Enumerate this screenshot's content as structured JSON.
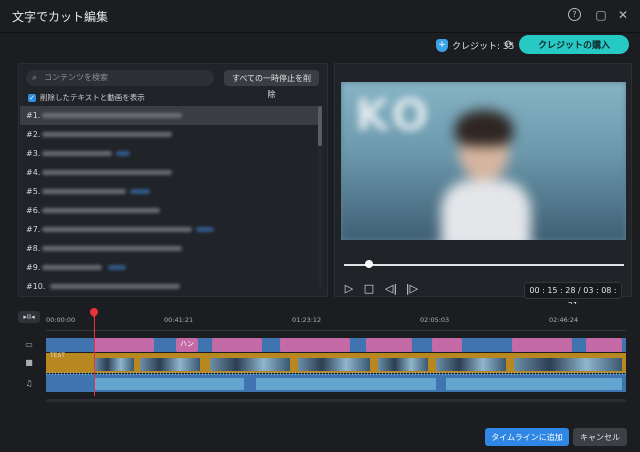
{
  "window": {
    "title": "文字でカット編集"
  },
  "titlebar": {
    "help_icon": "help-icon",
    "maximize_icon": "maximize-icon",
    "close_icon": "close-icon"
  },
  "toolbar": {
    "credits_label": "クレジット: 35",
    "buy_label": "クレジットの購入",
    "accent_color": "#26c9c4"
  },
  "left": {
    "search_placeholder": "コンテンツを検索",
    "clear_pauses_label": "すべての一時停止を削除",
    "show_deleted_label": "削除したテキストと動画を表示",
    "rows": [
      "#1.",
      "#2.",
      "#3.",
      "#4.",
      "#5.",
      "#6.",
      "#7.",
      "#8.",
      "#9.",
      "#10."
    ]
  },
  "player": {
    "preview_lettering": "KO",
    "timecode": "00 : 15 : 28 / 03 : 08 : 21",
    "progress": 0.09
  },
  "timeline": {
    "ruler_labels": [
      "00:00:00",
      "00:41:21",
      "01:23:12",
      "02:05:03",
      "02:46:24"
    ],
    "clip_label": "TEST",
    "subtitle_label": "ハン"
  },
  "footer": {
    "add_label": "タイムラインに追加",
    "cancel_label": "キャンセル",
    "add_color": "#2f86e4"
  }
}
